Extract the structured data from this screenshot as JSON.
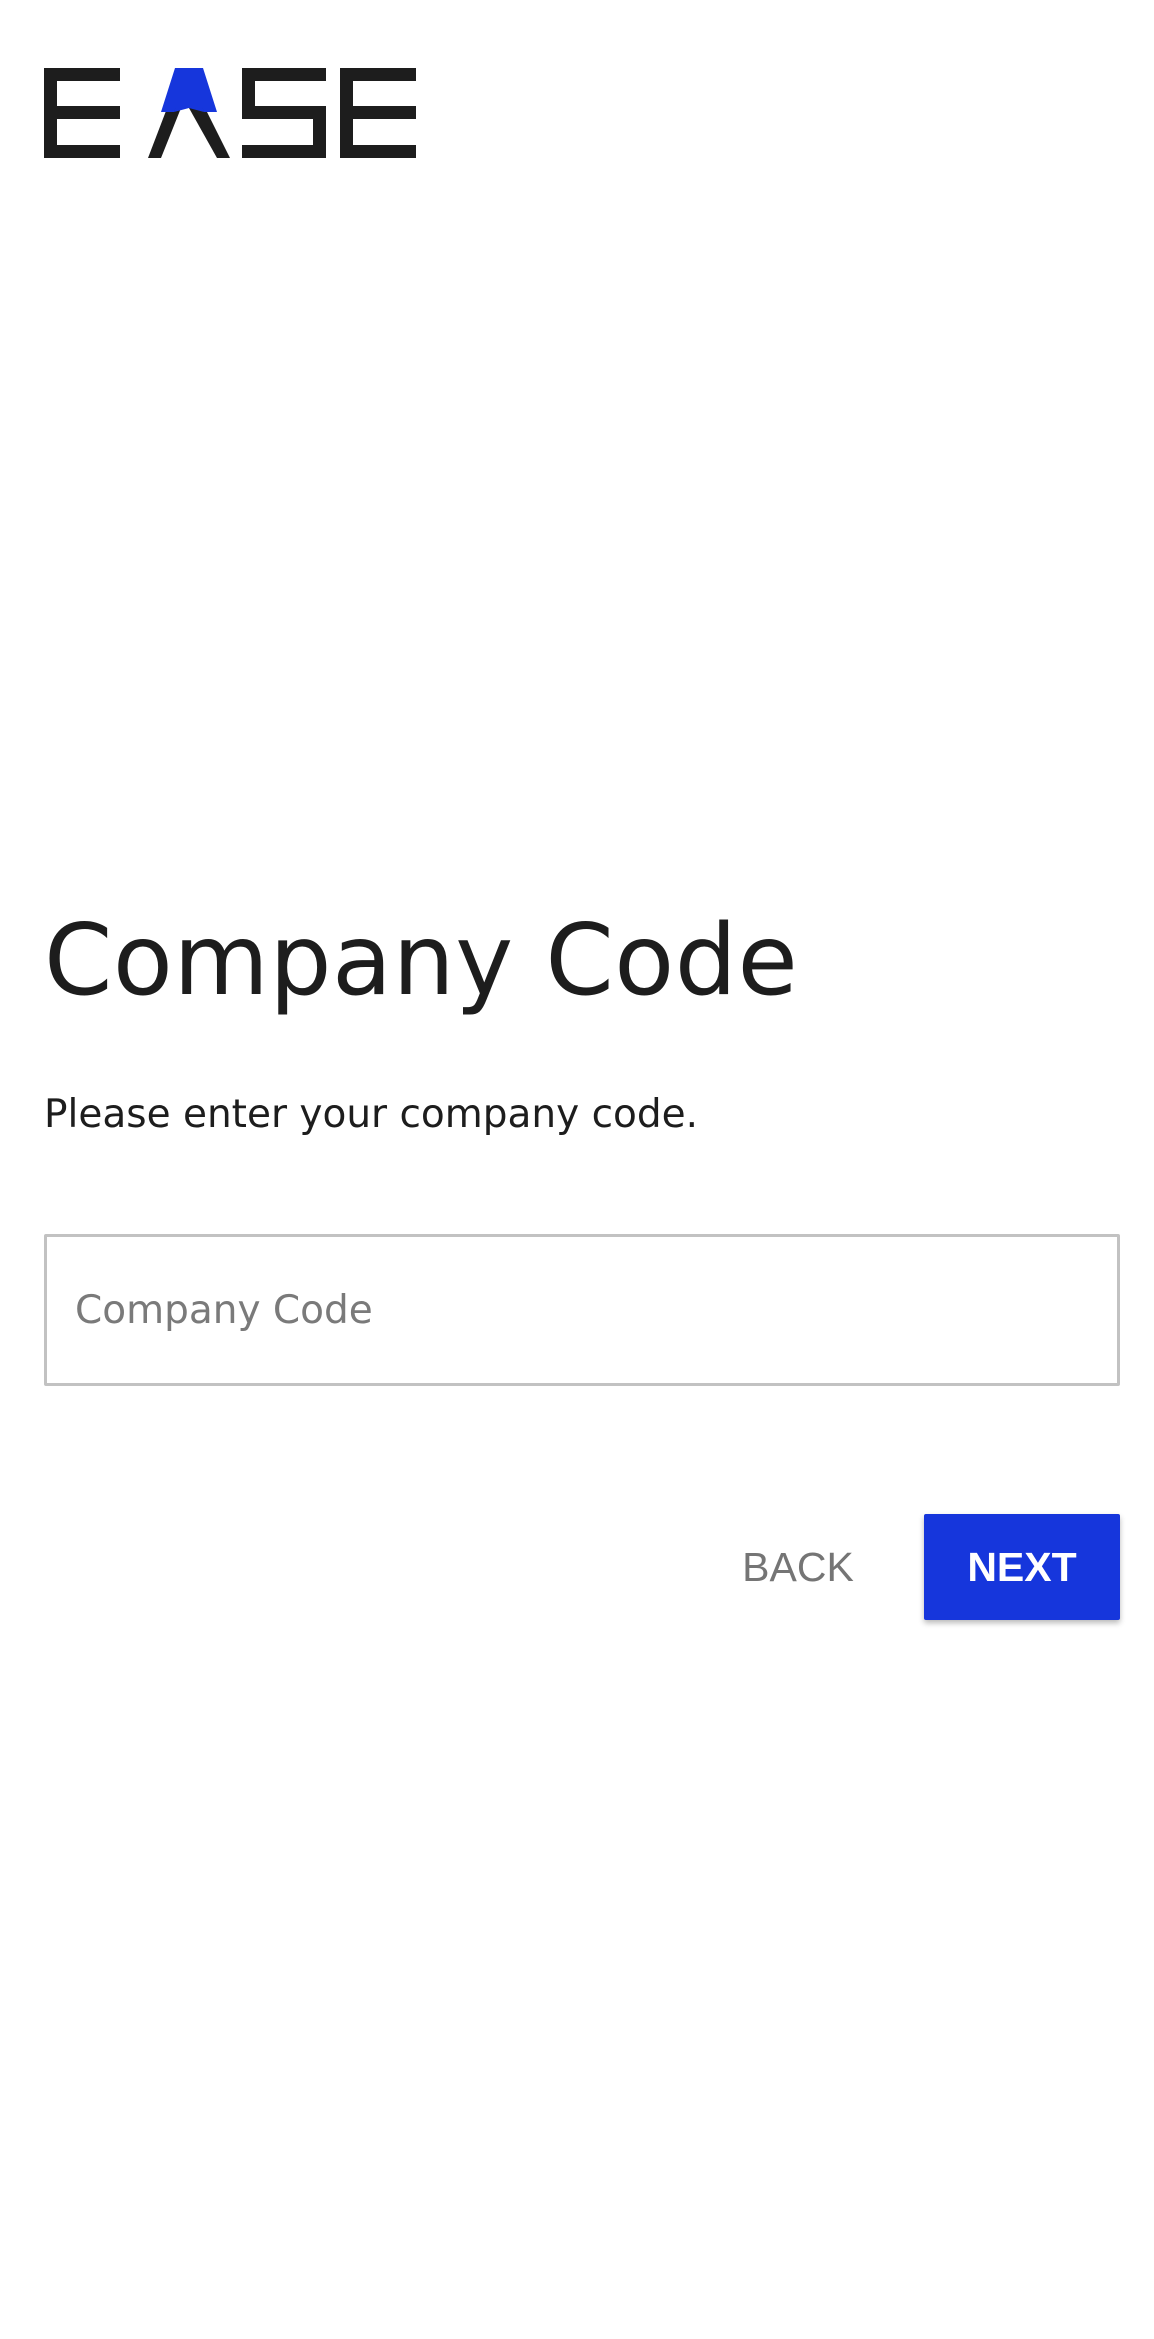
{
  "brand": {
    "logo_text": "EASE",
    "accent_color": "#1636dc",
    "text_color": "#1d1d1d"
  },
  "page": {
    "title": "Company Code",
    "subtitle": "Please enter your company code."
  },
  "form": {
    "company_code": {
      "value": "",
      "placeholder": "Company Code"
    }
  },
  "actions": {
    "back_label": "BACK",
    "next_label": "NEXT"
  }
}
